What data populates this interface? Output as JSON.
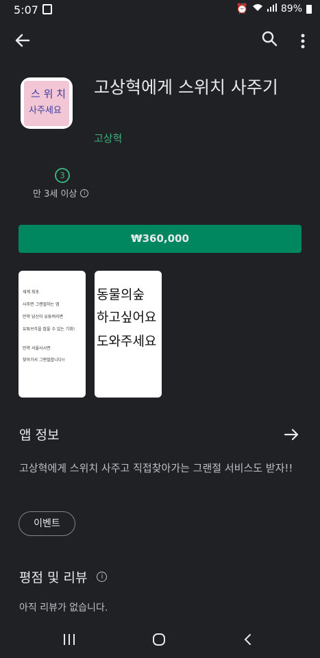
{
  "status_bar": {
    "time": "5:07",
    "battery": "89%",
    "icons": [
      "twitch-icon",
      "alarm-icon",
      "volte-icon",
      "wifi-icon",
      "signal-icon",
      "battery-icon"
    ]
  },
  "app": {
    "title": "고상혁에게 스위치 사주기",
    "developer": "고상혁",
    "icon_line1": "스 위 치",
    "icon_line2": "사주세요"
  },
  "rating": {
    "age_number": "3",
    "age_label": "만 3세 이상"
  },
  "price_button": "₩360,000",
  "screenshots": {
    "shot1_lines": [
      "세계 최초",
      "사주면 그랜절하는 앱",
      "만약 당신이 유튜버라면",
      "유튜브각을 잡을 수 있는 기회!",
      "",
      "만약 서울사시면",
      "찾아가서 그랜절합니다!!"
    ],
    "shot2_lines": [
      "동물의숲",
      "하고싶어요",
      "도와주세요"
    ]
  },
  "about": {
    "title": "앱 정보",
    "description": "고상혁에게 스위치 사주고 직접찾아가는 그랜절 서비스도 받자!!",
    "chip": "이벤트"
  },
  "reviews": {
    "title": "평점 및 리뷰",
    "empty": "아직 리뷰가 없습니다."
  },
  "colors": {
    "background": "#202124",
    "accent": "#01875f",
    "developer_green": "#3bb27a"
  }
}
